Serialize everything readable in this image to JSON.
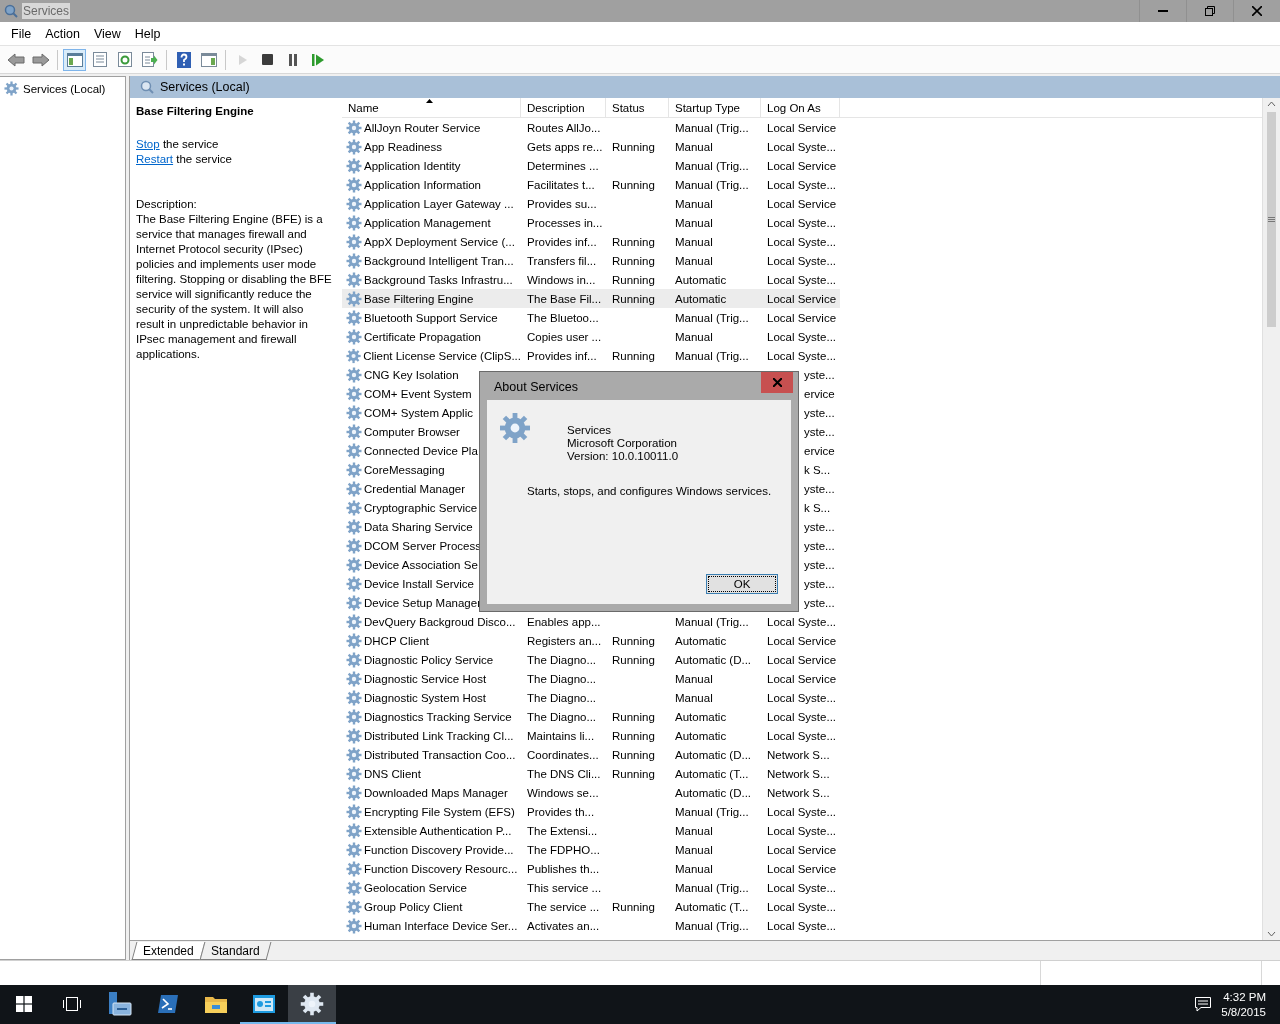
{
  "window": {
    "title": "Services"
  },
  "menu": [
    "File",
    "Action",
    "View",
    "Help"
  ],
  "toolbar": [
    {
      "kind": "back",
      "pressed": false,
      "disabled": false
    },
    {
      "kind": "forward",
      "pressed": false,
      "disabled": false
    },
    {
      "kind": "tree",
      "pressed": true,
      "disabled": false
    },
    {
      "kind": "properties",
      "pressed": false,
      "disabled": false
    },
    {
      "kind": "refresh",
      "pressed": false,
      "disabled": false
    },
    {
      "kind": "export",
      "pressed": false,
      "disabled": false
    },
    {
      "kind": "help",
      "pressed": false,
      "disabled": false
    },
    {
      "kind": "pane",
      "pressed": false,
      "disabled": false
    },
    {
      "kind": "start",
      "pressed": false,
      "disabled": true
    },
    {
      "kind": "stop",
      "pressed": false,
      "disabled": false
    },
    {
      "kind": "pause",
      "pressed": false,
      "disabled": false
    },
    {
      "kind": "resume",
      "pressed": false,
      "disabled": false
    }
  ],
  "tree": {
    "items": [
      {
        "label": "Services (Local)",
        "selected": false
      }
    ]
  },
  "panel": {
    "title": "Services (Local)"
  },
  "details": {
    "title": "Base Filtering Engine",
    "actions": [
      {
        "link": "Stop",
        "text": "the service"
      },
      {
        "link": "Restart",
        "text": "the service"
      }
    ],
    "description_label": "Description:",
    "description": "The Base Filtering Engine (BFE) is a service that manages firewall and Internet Protocol security (IPsec) policies and implements user mode filtering. Stopping or disabling the BFE service will significantly reduce the security of the system. It will also result in unpredictable behavior in IPsec management and firewall applications."
  },
  "table": {
    "columns": [
      {
        "label": "Name",
        "sorted": true
      },
      {
        "label": "Description",
        "sorted": false
      },
      {
        "label": "Status",
        "sorted": false
      },
      {
        "label": "Startup Type",
        "sorted": false
      },
      {
        "label": "Log On As",
        "sorted": false
      }
    ],
    "rows": [
      {
        "name": "AllJoyn Router Service",
        "description": "Routes AllJo...",
        "status": "",
        "startup": "Manual (Trig...",
        "logon": "Local Service",
        "selected": false,
        "covered": false
      },
      {
        "name": "App Readiness",
        "description": "Gets apps re...",
        "status": "Running",
        "startup": "Manual",
        "logon": "Local Syste...",
        "selected": false,
        "covered": false
      },
      {
        "name": "Application Identity",
        "description": "Determines ...",
        "status": "",
        "startup": "Manual (Trig...",
        "logon": "Local Service",
        "selected": false,
        "covered": false
      },
      {
        "name": "Application Information",
        "description": "Facilitates t...",
        "status": "Running",
        "startup": "Manual (Trig...",
        "logon": "Local Syste...",
        "selected": false,
        "covered": false
      },
      {
        "name": "Application Layer Gateway ...",
        "description": "Provides su...",
        "status": "",
        "startup": "Manual",
        "logon": "Local Service",
        "selected": false,
        "covered": false
      },
      {
        "name": "Application Management",
        "description": "Processes in...",
        "status": "",
        "startup": "Manual",
        "logon": "Local Syste...",
        "selected": false,
        "covered": false
      },
      {
        "name": "AppX Deployment Service (...",
        "description": "Provides inf...",
        "status": "Running",
        "startup": "Manual",
        "logon": "Local Syste...",
        "selected": false,
        "covered": false
      },
      {
        "name": "Background Intelligent Tran...",
        "description": "Transfers fil...",
        "status": "Running",
        "startup": "Manual",
        "logon": "Local Syste...",
        "selected": false,
        "covered": false
      },
      {
        "name": "Background Tasks Infrastru...",
        "description": "Windows in...",
        "status": "Running",
        "startup": "Automatic",
        "logon": "Local Syste...",
        "selected": false,
        "covered": false
      },
      {
        "name": "Base Filtering Engine",
        "description": "The Base Fil...",
        "status": "Running",
        "startup": "Automatic",
        "logon": "Local Service",
        "selected": true,
        "covered": false
      },
      {
        "name": "Bluetooth Support Service",
        "description": "The Bluetoo...",
        "status": "",
        "startup": "Manual (Trig...",
        "logon": "Local Service",
        "selected": false,
        "covered": false
      },
      {
        "name": "Certificate Propagation",
        "description": "Copies user ...",
        "status": "",
        "startup": "Manual",
        "logon": "Local Syste...",
        "selected": false,
        "covered": false
      },
      {
        "name": "Client License Service (ClipS...",
        "description": "Provides inf...",
        "status": "Running",
        "startup": "Manual (Trig...",
        "logon": "Local Syste...",
        "selected": false,
        "covered": false
      },
      {
        "name": "CNG Key Isolation",
        "logon": "yste...",
        "selected": false,
        "covered": true
      },
      {
        "name": "COM+ Event System",
        "logon": "ervice",
        "selected": false,
        "covered": true
      },
      {
        "name": "COM+ System Applic",
        "logon": "yste...",
        "selected": false,
        "covered": true
      },
      {
        "name": "Computer Browser",
        "logon": "yste...",
        "selected": false,
        "covered": true
      },
      {
        "name": "Connected Device Pla",
        "logon": "ervice",
        "selected": false,
        "covered": true
      },
      {
        "name": "CoreMessaging",
        "logon": "k S...",
        "selected": false,
        "covered": true
      },
      {
        "name": "Credential Manager",
        "logon": "yste...",
        "selected": false,
        "covered": true
      },
      {
        "name": "Cryptographic Service",
        "logon": "k S...",
        "selected": false,
        "covered": true
      },
      {
        "name": "Data Sharing Service",
        "logon": "yste...",
        "selected": false,
        "covered": true
      },
      {
        "name": "DCOM Server Process",
        "logon": "yste...",
        "selected": false,
        "covered": true
      },
      {
        "name": "Device Association Se",
        "logon": "yste...",
        "selected": false,
        "covered": true
      },
      {
        "name": "Device Install Service",
        "logon": "yste...",
        "selected": false,
        "covered": true
      },
      {
        "name": "Device Setup Manager",
        "logon": "yste...",
        "selected": false,
        "covered": true
      },
      {
        "name": "DevQuery Backgroud Disco...",
        "description": "Enables app...",
        "status": "",
        "startup": "Manual (Trig...",
        "logon": "Local Syste...",
        "selected": false,
        "covered": false
      },
      {
        "name": "DHCP Client",
        "description": "Registers an...",
        "status": "Running",
        "startup": "Automatic",
        "logon": "Local Service",
        "selected": false,
        "covered": false
      },
      {
        "name": "Diagnostic Policy Service",
        "description": "The Diagno...",
        "status": "Running",
        "startup": "Automatic (D...",
        "logon": "Local Service",
        "selected": false,
        "covered": false
      },
      {
        "name": "Diagnostic Service Host",
        "description": "The Diagno...",
        "status": "",
        "startup": "Manual",
        "logon": "Local Service",
        "selected": false,
        "covered": false
      },
      {
        "name": "Diagnostic System Host",
        "description": "The Diagno...",
        "status": "",
        "startup": "Manual",
        "logon": "Local Syste...",
        "selected": false,
        "covered": false
      },
      {
        "name": "Diagnostics Tracking Service",
        "description": "The Diagno...",
        "status": "Running",
        "startup": "Automatic",
        "logon": "Local Syste...",
        "selected": false,
        "covered": false
      },
      {
        "name": "Distributed Link Tracking Cl...",
        "description": "Maintains li...",
        "status": "Running",
        "startup": "Automatic",
        "logon": "Local Syste...",
        "selected": false,
        "covered": false
      },
      {
        "name": "Distributed Transaction Coo...",
        "description": "Coordinates...",
        "status": "Running",
        "startup": "Automatic (D...",
        "logon": "Network S...",
        "selected": false,
        "covered": false
      },
      {
        "name": "DNS Client",
        "description": "The DNS Cli...",
        "status": "Running",
        "startup": "Automatic (T...",
        "logon": "Network S...",
        "selected": false,
        "covered": false
      },
      {
        "name": "Downloaded Maps Manager",
        "description": "Windows se...",
        "status": "",
        "startup": "Automatic (D...",
        "logon": "Network S...",
        "selected": false,
        "covered": false
      },
      {
        "name": "Encrypting File System (EFS)",
        "description": "Provides th...",
        "status": "",
        "startup": "Manual (Trig...",
        "logon": "Local Syste...",
        "selected": false,
        "covered": false
      },
      {
        "name": "Extensible Authentication P...",
        "description": "The Extensi...",
        "status": "",
        "startup": "Manual",
        "logon": "Local Syste...",
        "selected": false,
        "covered": false
      },
      {
        "name": "Function Discovery Provide...",
        "description": "The FDPHO...",
        "status": "",
        "startup": "Manual",
        "logon": "Local Service",
        "selected": false,
        "covered": false
      },
      {
        "name": "Function Discovery Resourc...",
        "description": "Publishes th...",
        "status": "",
        "startup": "Manual",
        "logon": "Local Service",
        "selected": false,
        "covered": false
      },
      {
        "name": "Geolocation Service",
        "description": "This service ...",
        "status": "",
        "startup": "Manual (Trig...",
        "logon": "Local Syste...",
        "selected": false,
        "covered": false
      },
      {
        "name": "Group Policy Client",
        "description": "The service ...",
        "status": "Running",
        "startup": "Automatic (T...",
        "logon": "Local Syste...",
        "selected": false,
        "covered": false
      },
      {
        "name": "Human Interface Device Ser...",
        "description": "Activates an...",
        "status": "",
        "startup": "Manual (Trig...",
        "logon": "Local Syste...",
        "selected": false,
        "covered": false
      }
    ]
  },
  "view_tabs": [
    {
      "label": "Extended",
      "selected": true
    },
    {
      "label": "Standard",
      "selected": false
    }
  ],
  "dialog": {
    "title": "About Services",
    "product": "Services",
    "company": "Microsoft Corporation",
    "version": "Version: 10.0.10011.0",
    "summary": "Starts, stops, and configures Windows services.",
    "button": "OK"
  },
  "taskbar": {
    "items": [
      {
        "kind": "start",
        "running": false,
        "selected": false
      },
      {
        "kind": "taskview",
        "running": false,
        "selected": false
      },
      {
        "kind": "server",
        "running": false,
        "selected": false
      },
      {
        "kind": "powershell",
        "running": false,
        "selected": false
      },
      {
        "kind": "folder",
        "running": false,
        "selected": false
      },
      {
        "kind": "app",
        "running": true,
        "selected": false
      },
      {
        "kind": "services",
        "running": true,
        "selected": true
      }
    ],
    "time": "4:32 PM",
    "date": "5/8/2015"
  }
}
